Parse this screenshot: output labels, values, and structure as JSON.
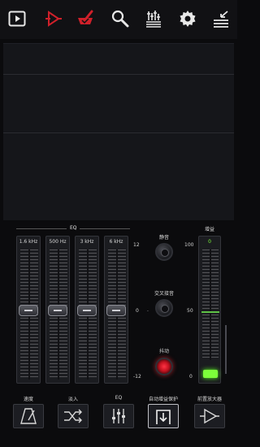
{
  "toolbar": {
    "icons": [
      "play-icon",
      "output-signal-icon",
      "mortar-pestle-icon",
      "search-icon",
      "equalizer-icon",
      "gear-icon",
      "collapse-list-icon"
    ],
    "accent_red": "#d0202a"
  },
  "eq": {
    "section_label": "EQ",
    "bands": [
      {
        "label": "1.6 kHz"
      },
      {
        "label": "500 Hz"
      },
      {
        "label": "3 kHz"
      },
      {
        "label": "6 kHz"
      }
    ],
    "scale": {
      "top": "12",
      "middle": "0",
      "bottom": "-12"
    }
  },
  "controls": {
    "mute_label": "静音",
    "crossfade_label": "交叉接音",
    "vibrate_label": "抖动",
    "separator": "."
  },
  "gain": {
    "label": "增益",
    "scale_top": "100",
    "scale_mid": "50",
    "scale_bottom": "0",
    "current_value": "0",
    "led_color": "#7dff3a"
  },
  "bottom": {
    "labels": [
      "速度",
      "淡入",
      "EQ",
      "自动增益保护",
      "前置放大器"
    ]
  }
}
